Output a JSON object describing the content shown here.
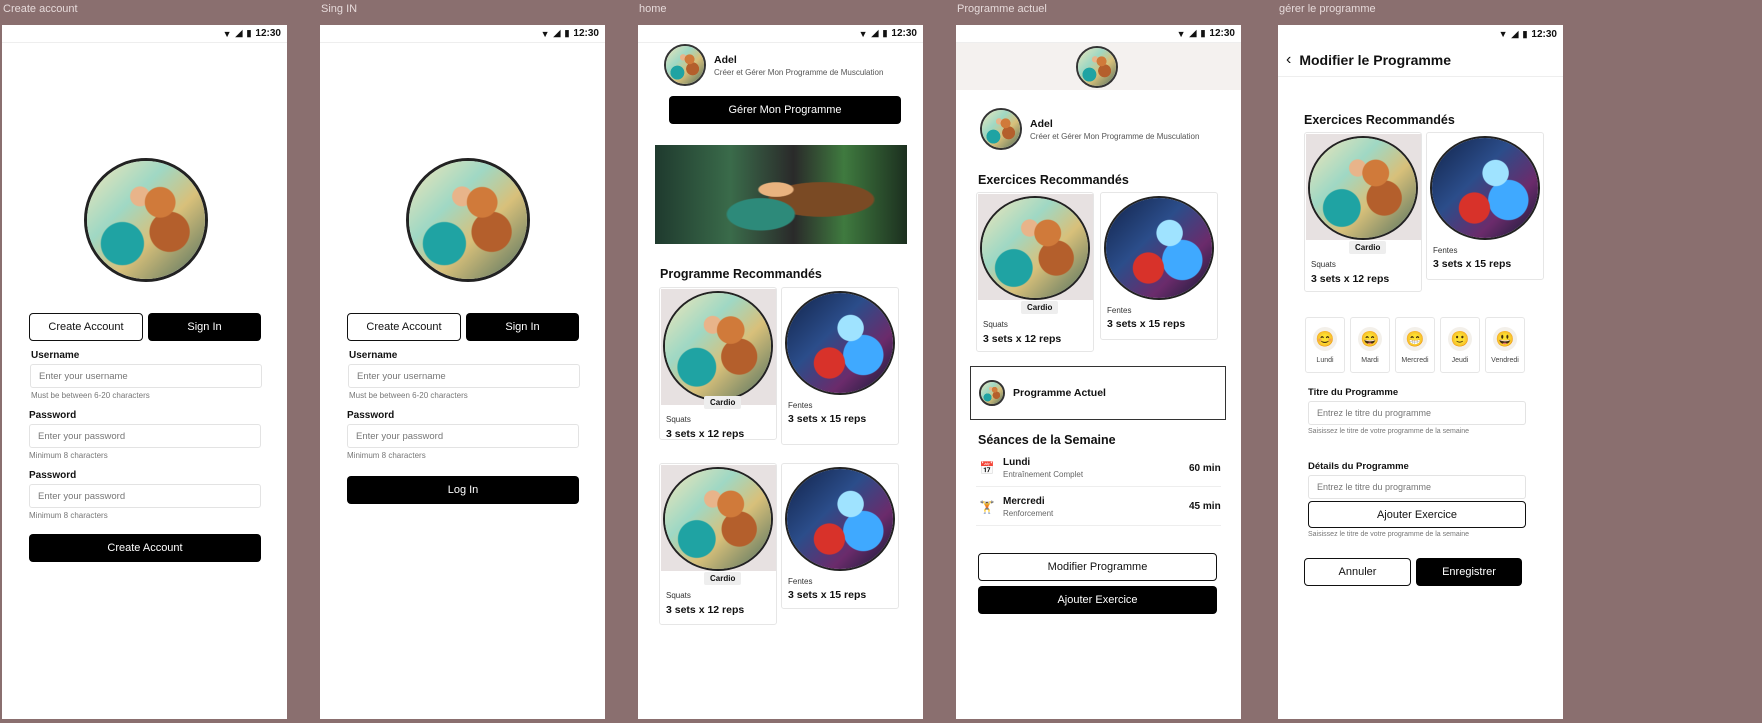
{
  "status": {
    "time": "12:30"
  },
  "labels": {
    "create_account": "Create account",
    "sign_in": "Sing IN",
    "home": "home",
    "current": "Programme actuel",
    "manage": "gérer le programme"
  },
  "auth": {
    "create_tab": "Create Account",
    "signin_tab": "Sign In",
    "username_label": "Username",
    "username_placeholder": "Enter your username",
    "username_hint": "Must be between 6-20 characters",
    "password_label": "Password",
    "password_placeholder": "Enter your password",
    "password_hint": "Minimum 8 characters",
    "create_button": "Create Account",
    "login_button": "Log In"
  },
  "profile": {
    "name": "Adel",
    "subtitle": "Créer et Gérer Mon Programme de Musculation"
  },
  "home": {
    "manage_button": "Gérer Mon Programme",
    "section_title": "Programme Recommandés"
  },
  "cards": {
    "squats": {
      "tag": "Cardio",
      "category": "Squats",
      "sets": "3 sets x 12 reps"
    },
    "fentes": {
      "category": "Fentes",
      "sets": "3 sets x 15 reps"
    }
  },
  "current": {
    "recommended_title": "Exercices Recommandés",
    "current_program": "Programme Actuel",
    "week_title": "Séances de la Semaine",
    "sessions": [
      {
        "icon": "calendar-icon",
        "day": "Lundi",
        "type": "Entraînement Complet",
        "duration": "60 min"
      },
      {
        "icon": "dumbbell-icon",
        "day": "Mercredi",
        "type": "Renforcement",
        "duration": "45 min"
      }
    ],
    "modify_button": "Modifier Programme",
    "add_button": "Ajouter Exercice"
  },
  "manage": {
    "title": "Modifier le Programme",
    "recommended_title": "Exercices Recommandés",
    "days": [
      "Lundi",
      "Mardi",
      "Mercredi",
      "Jeudi",
      "Vendredi"
    ],
    "title_label": "Titre du Programme",
    "title_placeholder": "Entrez le titre du programme",
    "title_hint": "Saisissez le titre de votre programme de la semaine",
    "details_label": "Détails du Programme",
    "details_placeholder": "Entrez le titre du programme",
    "add_exercise": "Ajouter Exercice",
    "details_hint": "Saisissez le titre de votre programme de la semaine",
    "cancel": "Annuler",
    "save": "Enregistrer"
  }
}
